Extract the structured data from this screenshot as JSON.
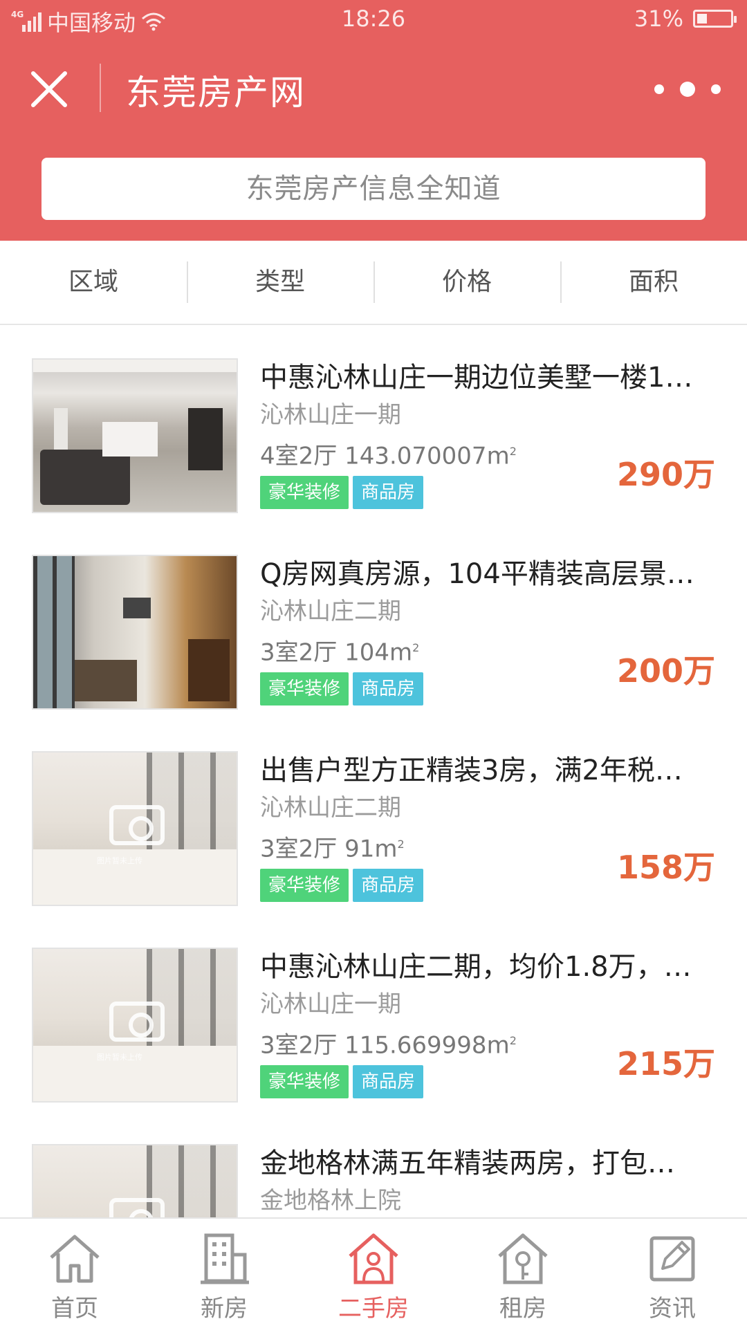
{
  "status_bar": {
    "network": "4G",
    "carrier": "中国移动",
    "time": "18:26",
    "battery": "31%",
    "battery_level": 0.31
  },
  "header": {
    "title": "东莞房产网"
  },
  "search": {
    "placeholder": "东莞房产信息全知道"
  },
  "filters": [
    "区域",
    "类型",
    "价格",
    "面积"
  ],
  "listings": [
    {
      "title": "中惠沁林山庄一期边位美墅一楼1…",
      "community": "沁林山庄一期",
      "spec": "4室2厅 143.070007m",
      "spec_sup": "2",
      "tags": [
        "豪华装修",
        "商品房"
      ],
      "price": "290万"
    },
    {
      "title": "Q房网真房源，104平精装高层景…",
      "community": "沁林山庄二期",
      "spec": "3室2厅 104m",
      "spec_sup": "2",
      "tags": [
        "豪华装修",
        "商品房"
      ],
      "price": "200万"
    },
    {
      "title": "出售户型方正精装3房，满2年税…",
      "community": "沁林山庄二期",
      "spec": "3室2厅 91m",
      "spec_sup": "2",
      "tags": [
        "豪华装修",
        "商品房"
      ],
      "price": "158万"
    },
    {
      "title": "中惠沁林山庄二期，均价1.8万，…",
      "community": "沁林山庄一期",
      "spec": "3室2厅 115.669998m",
      "spec_sup": "2",
      "tags": [
        "豪华装修",
        "商品房"
      ],
      "price": "215万"
    },
    {
      "title": "金地格林满五年精装两房，打包…",
      "community": "金地格林上院"
    }
  ],
  "placeholder_caption": "图片暂未上传",
  "tabbar": {
    "tabs": [
      {
        "label": "首页",
        "icon": "home-icon"
      },
      {
        "label": "新房",
        "icon": "building-icon"
      },
      {
        "label": "二手房",
        "icon": "house-icon",
        "active": true
      },
      {
        "label": "租房",
        "icon": "rent-icon"
      },
      {
        "label": "资讯",
        "icon": "news-edit-icon"
      }
    ]
  },
  "colors": {
    "brand_red": "#e6605f",
    "price_orange": "#e4663c",
    "tag_green": "#4fd37a",
    "tag_blue": "#4dc3dc",
    "inactive_tab": "#888888"
  }
}
